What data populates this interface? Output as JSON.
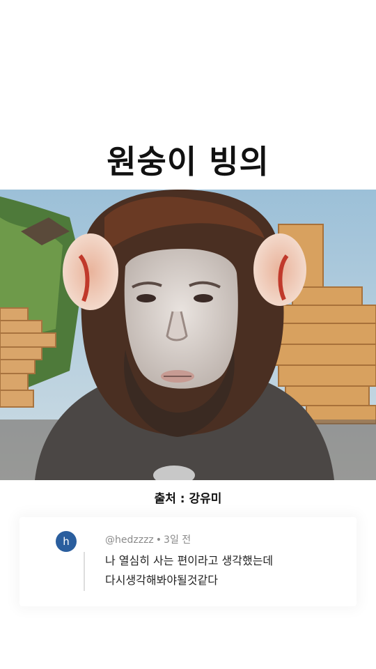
{
  "title": "원숭이 빙의",
  "source": "출처 : 강유미",
  "comment": {
    "avatar_letter": "h",
    "username": "@hedzzzz",
    "separator": "•",
    "time": "3일 전",
    "lines": [
      "나 열심히 사는 편이라고 생각했는데",
      "다시생각해봐야될것같다"
    ]
  },
  "colors": {
    "avatar_bg": "#2a5e9e",
    "title_text": "#111111",
    "meta_text": "#8a8a8a"
  }
}
